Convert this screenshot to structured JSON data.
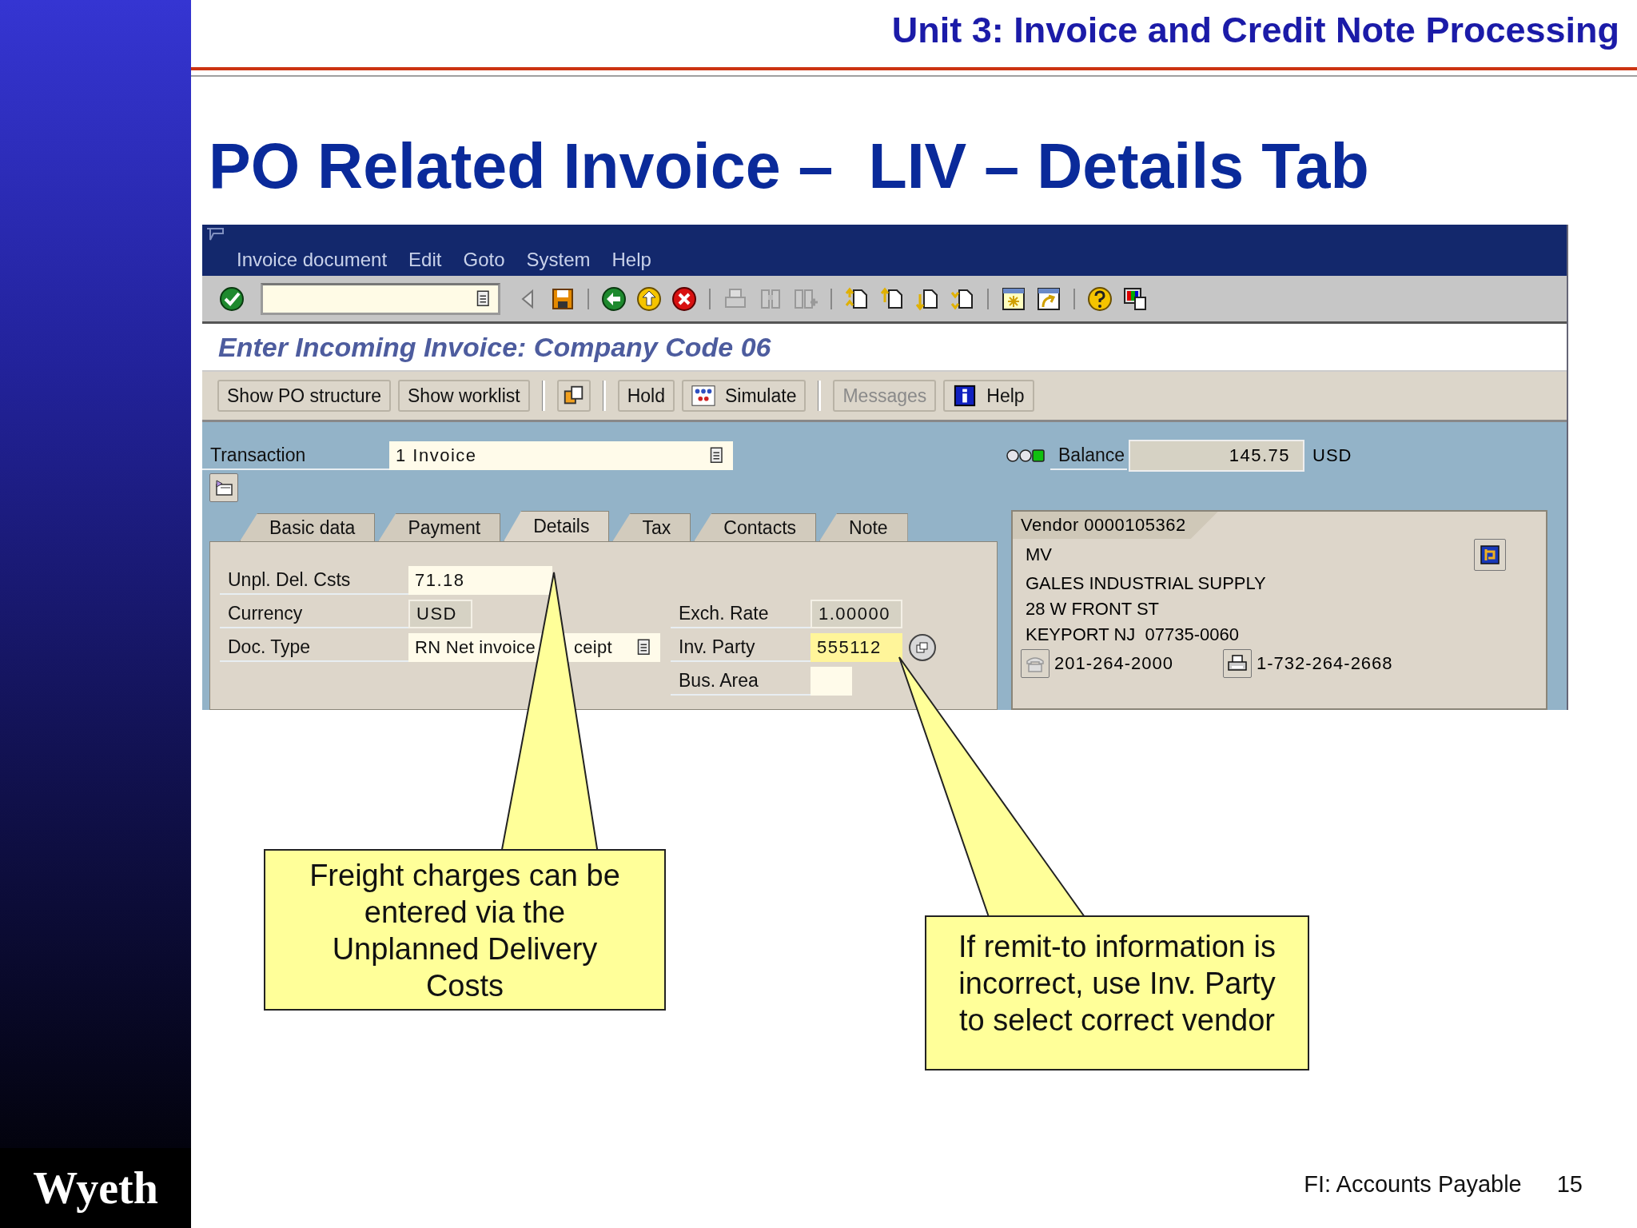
{
  "slide": {
    "header": "Unit 3: Invoice and Credit Note Processing",
    "title": "PO Related Invoice –  LIV – Details Tab",
    "logo": "Wyeth",
    "footer": [
      "FI: Accounts Payable",
      "15"
    ]
  },
  "sap_window": {
    "menu": [
      "Invoice document",
      "Edit",
      "Goto",
      "System",
      "Help"
    ],
    "screen_title": "Enter Incoming Invoice: Company Code 06",
    "app_toolbar_groups": [
      {
        "buttons": [
          {
            "kind": "text",
            "label": "Show PO structure",
            "disabled": false
          },
          {
            "kind": "text",
            "label": "Show worklist",
            "disabled": false
          }
        ]
      },
      {
        "buttons": [
          {
            "kind": "icon",
            "disabled": false
          }
        ]
      },
      {
        "buttons": [
          {
            "kind": "text",
            "label": "Hold",
            "disabled": false
          },
          {
            "kind": "icon_text",
            "label": "Simulate",
            "disabled": false
          }
        ]
      },
      {
        "buttons": [
          {
            "kind": "text",
            "label": "Messages",
            "disabled": true
          },
          {
            "kind": "icon_text",
            "label": "Help",
            "disabled": false
          }
        ]
      }
    ],
    "transaction": {
      "label": "Transaction",
      "value": "1 Invoice"
    },
    "balance": {
      "ok": true,
      "label": "Balance",
      "value": "145.75",
      "currency": "USD"
    },
    "tabs": [
      {
        "label": "Basic data",
        "selected": false
      },
      {
        "label": "Payment",
        "selected": false
      },
      {
        "label": "Details",
        "selected": true
      },
      {
        "label": "Tax",
        "selected": false
      },
      {
        "label": "Contacts",
        "selected": false
      },
      {
        "label": "Note",
        "selected": false
      }
    ],
    "fields_left": [
      {
        "label": "Unpl. Del. Csts",
        "value": "71.18",
        "kind": "input"
      },
      {
        "label": "Currency",
        "value": "USD",
        "kind": "display"
      },
      {
        "label": "Doc. Type",
        "value": "RN Net invoice",
        "value_end": "ceipt",
        "kind": "dropdown"
      }
    ],
    "fields_right": [
      {
        "label": "Exch. Rate",
        "value": "1.00000",
        "kind": "display"
      },
      {
        "label": "Inv. Party",
        "value": "555112",
        "kind": "search"
      },
      {
        "label": "Bus. Area",
        "kind": "input"
      }
    ],
    "vendor": {
      "title": "Vendor 0000105362",
      "lines": [
        "MV",
        "GALES INDUSTRIAL SUPPLY",
        "28 W FRONT ST",
        "KEYPORT NJ  07735-0060"
      ],
      "phone": "201-264-2000",
      "fax": "1-732-264-2668"
    }
  },
  "callouts": [
    {
      "text": "Freight charges can be entered via the Unplanned Delivery Costs"
    },
    {
      "text": "If remit-to information is incorrect, use Inv. Party to select correct vendor"
    }
  ]
}
